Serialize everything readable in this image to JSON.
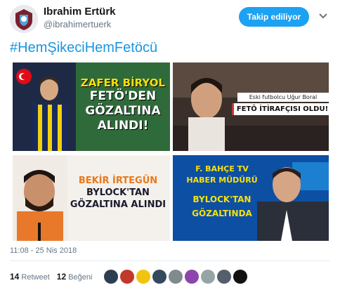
{
  "author": {
    "display_name": "Ibrahim Ertürk",
    "handle": "@ibrahimertuerk"
  },
  "follow_button": {
    "label": "Takip ediliyor"
  },
  "tweet": {
    "hashtag": "#HemŞikeciHemFetöcü",
    "timestamp": "11:08 - 25 Nis 2018"
  },
  "media": [
    {
      "lines": [
        "ZAFER BİRYOL",
        "FETÖ'DEN",
        "GÖZALTINA",
        "ALINDI!"
      ]
    },
    {
      "subtitle": "Eski futbolcu Uğur Boral",
      "headline": "FETÖ İTİRAFÇISI OLDU!"
    },
    {
      "lines": [
        "BEKİR İRTEGÜN",
        "BYLOCK'TAN",
        "GÖZALTINA ALINDI"
      ]
    },
    {
      "lines": [
        "F. BAHÇE TV",
        "HABER MÜDÜRÜ",
        "BYLOCK'TAN",
        "GÖZALTINDA"
      ]
    }
  ],
  "stats": {
    "retweets": {
      "count": "14",
      "label": "Retweet"
    },
    "likes": {
      "count": "12",
      "label": "Beğeni"
    }
  },
  "likers": [
    {
      "color": "#2c3e50"
    },
    {
      "color": "#c0392b"
    },
    {
      "color": "#f1c40f"
    },
    {
      "color": "#34495e"
    },
    {
      "color": "#7f8c8d"
    },
    {
      "color": "#8e44ad"
    },
    {
      "color": "#95a5a6"
    },
    {
      "color": "#555e6b"
    },
    {
      "color": "#111111"
    }
  ],
  "colors": {
    "accent": "#1da1f2",
    "hashtag": "#1b95e0",
    "muted": "#657786"
  }
}
